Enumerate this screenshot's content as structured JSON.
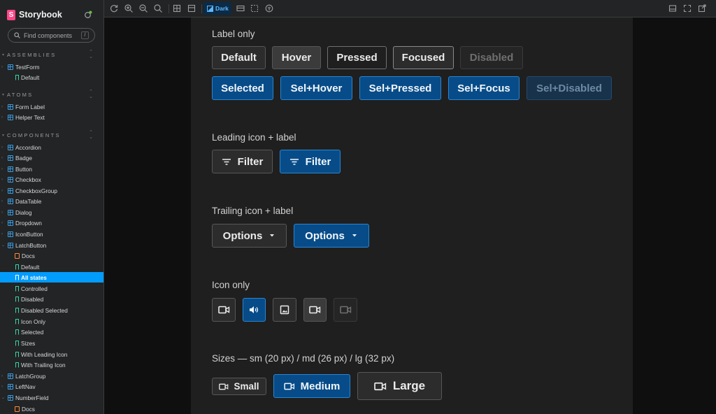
{
  "sidebar": {
    "brand": "Storybook",
    "search_placeholder": "Find components",
    "search_shortcut": "/",
    "sections": {
      "assemblies": "ASSEMBLIES",
      "atoms": "ATOMS",
      "components": "COMPONENTS"
    },
    "items": [
      "TestForm",
      "Default",
      "Form Label",
      "Helper Text",
      "Accordion",
      "Badge",
      "Button",
      "Checkbox",
      "CheckboxGroup",
      "DataTable",
      "Dialog",
      "Dropdown",
      "IconButton",
      "LatchButton",
      "Docs",
      "Default",
      "All states",
      "Controlled",
      "Disabled",
      "Disabled Selected",
      "Icon Only",
      "Selected",
      "Sizes",
      "With Leading Icon",
      "With Trailing Icon",
      "LatchGroup",
      "LeftNav",
      "NumberField",
      "Docs"
    ]
  },
  "toolbar": {
    "theme_label": "Dark"
  },
  "story": {
    "section_label_only": "Label only",
    "label_row1": [
      "Default",
      "Hover",
      "Pressed",
      "Focused",
      "Disabled"
    ],
    "label_row2": [
      "Selected",
      "Sel+Hover",
      "Sel+Pressed",
      "Sel+Focus",
      "Sel+Disabled"
    ],
    "section_leading": "Leading icon + label",
    "leading_buttons": [
      "Filter",
      "Filter"
    ],
    "section_trailing": "Trailing icon + label",
    "trailing_buttons": [
      "Options",
      "Options"
    ],
    "section_icon_only": "Icon only",
    "icon_only_buttons": [
      "video-icon",
      "volume-icon",
      "image-icon",
      "video-icon",
      "video-icon"
    ],
    "section_sizes": "Sizes — sm (20 px) / md (26 px) / lg (32 px)",
    "size_buttons": [
      "Small",
      "Medium",
      "Large"
    ]
  },
  "colors": {
    "selected_fill": "#074c88",
    "selected_border": "#2a85d0",
    "accent": "#029cfd",
    "brand": "#ff4785"
  }
}
